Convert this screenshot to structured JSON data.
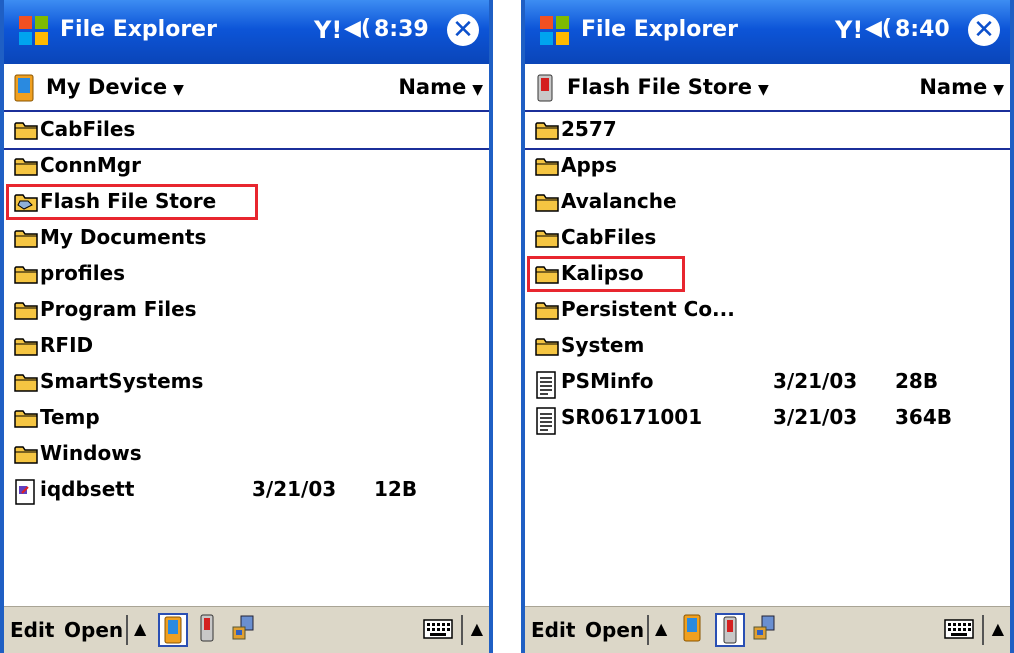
{
  "screens": [
    {
      "title": "File Explorer",
      "time": "8:39",
      "location": "My Device",
      "sort": "Name",
      "items": [
        {
          "type": "folder",
          "name": "CabFiles"
        },
        {
          "type": "folder",
          "name": "ConnMgr"
        },
        {
          "type": "storage",
          "name": "Flash File Store"
        },
        {
          "type": "folder",
          "name": "My Documents"
        },
        {
          "type": "folder",
          "name": "profiles"
        },
        {
          "type": "folder",
          "name": "Program Files"
        },
        {
          "type": "folder",
          "name": "RFID"
        },
        {
          "type": "folder",
          "name": "SmartSystems"
        },
        {
          "type": "folder",
          "name": "Temp"
        },
        {
          "type": "folder",
          "name": "Windows"
        },
        {
          "type": "file",
          "name": "iqdbsett",
          "date": "3/21/03",
          "size": "12B"
        }
      ],
      "selected_index": 0,
      "highlighted_index": 2,
      "active_store": "device"
    },
    {
      "title": "File Explorer",
      "time": "8:40",
      "location": "Flash File Store",
      "sort": "Name",
      "items": [
        {
          "type": "folder",
          "name": "2577"
        },
        {
          "type": "folder",
          "name": "Apps"
        },
        {
          "type": "folder",
          "name": "Avalanche"
        },
        {
          "type": "folder",
          "name": "CabFiles"
        },
        {
          "type": "folder",
          "name": "Kalipso"
        },
        {
          "type": "folder",
          "name": "Persistent Co..."
        },
        {
          "type": "folder",
          "name": "System"
        },
        {
          "type": "doc",
          "name": "PSMinfo",
          "date": "3/21/03",
          "size": "28B"
        },
        {
          "type": "doc",
          "name": "SR06171001",
          "date": "3/21/03",
          "size": "364B"
        }
      ],
      "selected_index": 0,
      "highlighted_index": 4,
      "active_store": "flash"
    }
  ],
  "menu": {
    "edit": "Edit",
    "open": "Open"
  },
  "colors": {
    "titlebar": "#0d55d8",
    "highlight": "#e8262f",
    "folder": "#f5c542",
    "menubar": "#dcd7c8"
  }
}
